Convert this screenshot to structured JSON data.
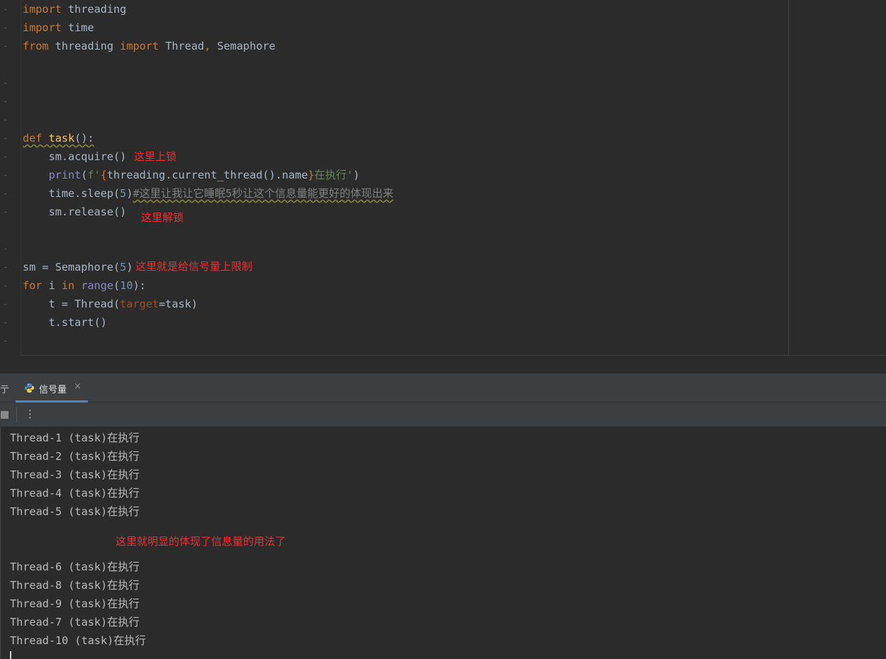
{
  "editor": {
    "imports": {
      "line1_kw": "import",
      "line1_mod": " threading",
      "line2_kw": "import",
      "line2_mod": " time",
      "line3_from": "from",
      "line3_mod": " threading ",
      "line3_import": "import",
      "line3_names": " Thread",
      "line3_comma": ",",
      "line3_sem": " Semaphore"
    },
    "def_line": {
      "kw": "def",
      "space": " ",
      "name": "task",
      "rest": "():"
    },
    "acquire_line": "    sm.acquire()",
    "print_line": {
      "indent": "    ",
      "fn": "print",
      "open": "(",
      "fstr_open": "f'",
      "brace_open": "{",
      "expr": "threading.current_thread().name",
      "brace_close": "}",
      "text": "在执行'",
      "close": ")"
    },
    "sleep_line": {
      "prefix": "    time.sleep(",
      "num": "5",
      "close": ")",
      "comment": "#这里让我让它睡眠5秒让这个信息量能更好的体现出来"
    },
    "release_line": "    sm.release()",
    "sm_line": {
      "prefix": "sm = Semaphore(",
      "num": "5",
      "close": ")"
    },
    "for_line": {
      "kw_for": "for",
      "var": " i ",
      "kw_in": "in",
      "space": " ",
      "fn": "range",
      "open": "(",
      "num": "10",
      "close": "):"
    },
    "thread_line": {
      "prefix": "    t = Thread(",
      "param": "target",
      "rest": "=task)"
    },
    "start_line": "    t.start()",
    "annotations": {
      "lock": "这里上锁",
      "unlock": "这里解锁",
      "limit": "这里就是给信号量上限制"
    }
  },
  "run_panel": {
    "cut_tab_label": "亍",
    "active_tab_label": "信号量",
    "close_glyph": "×",
    "kebab_glyph": "⋮",
    "output_group1": [
      "Thread-1 (task)在执行",
      "Thread-2 (task)在执行",
      "Thread-3 (task)在执行",
      "Thread-4 (task)在执行",
      "Thread-5 (task)在执行"
    ],
    "annotation": "这里就明显的体现了信息量的用法了",
    "output_group2": [
      "Thread-6 (task)在执行",
      "Thread-8 (task)在执行",
      "Thread-9 (task)在执行",
      "Thread-7 (task)在执行",
      "Thread-10 (task)在执行"
    ]
  },
  "colors": {
    "keyword": "#cc7832",
    "function_def": "#ffc66d",
    "builtin": "#8888c6",
    "number": "#6897bb",
    "string": "#6a8759",
    "annotation_red": "#f22e2e",
    "tab_accent": "#4a88c7"
  },
  "icons": {
    "tab_icon": "python-icon",
    "stop": "stop-icon",
    "more": "more-vertical-icon"
  }
}
